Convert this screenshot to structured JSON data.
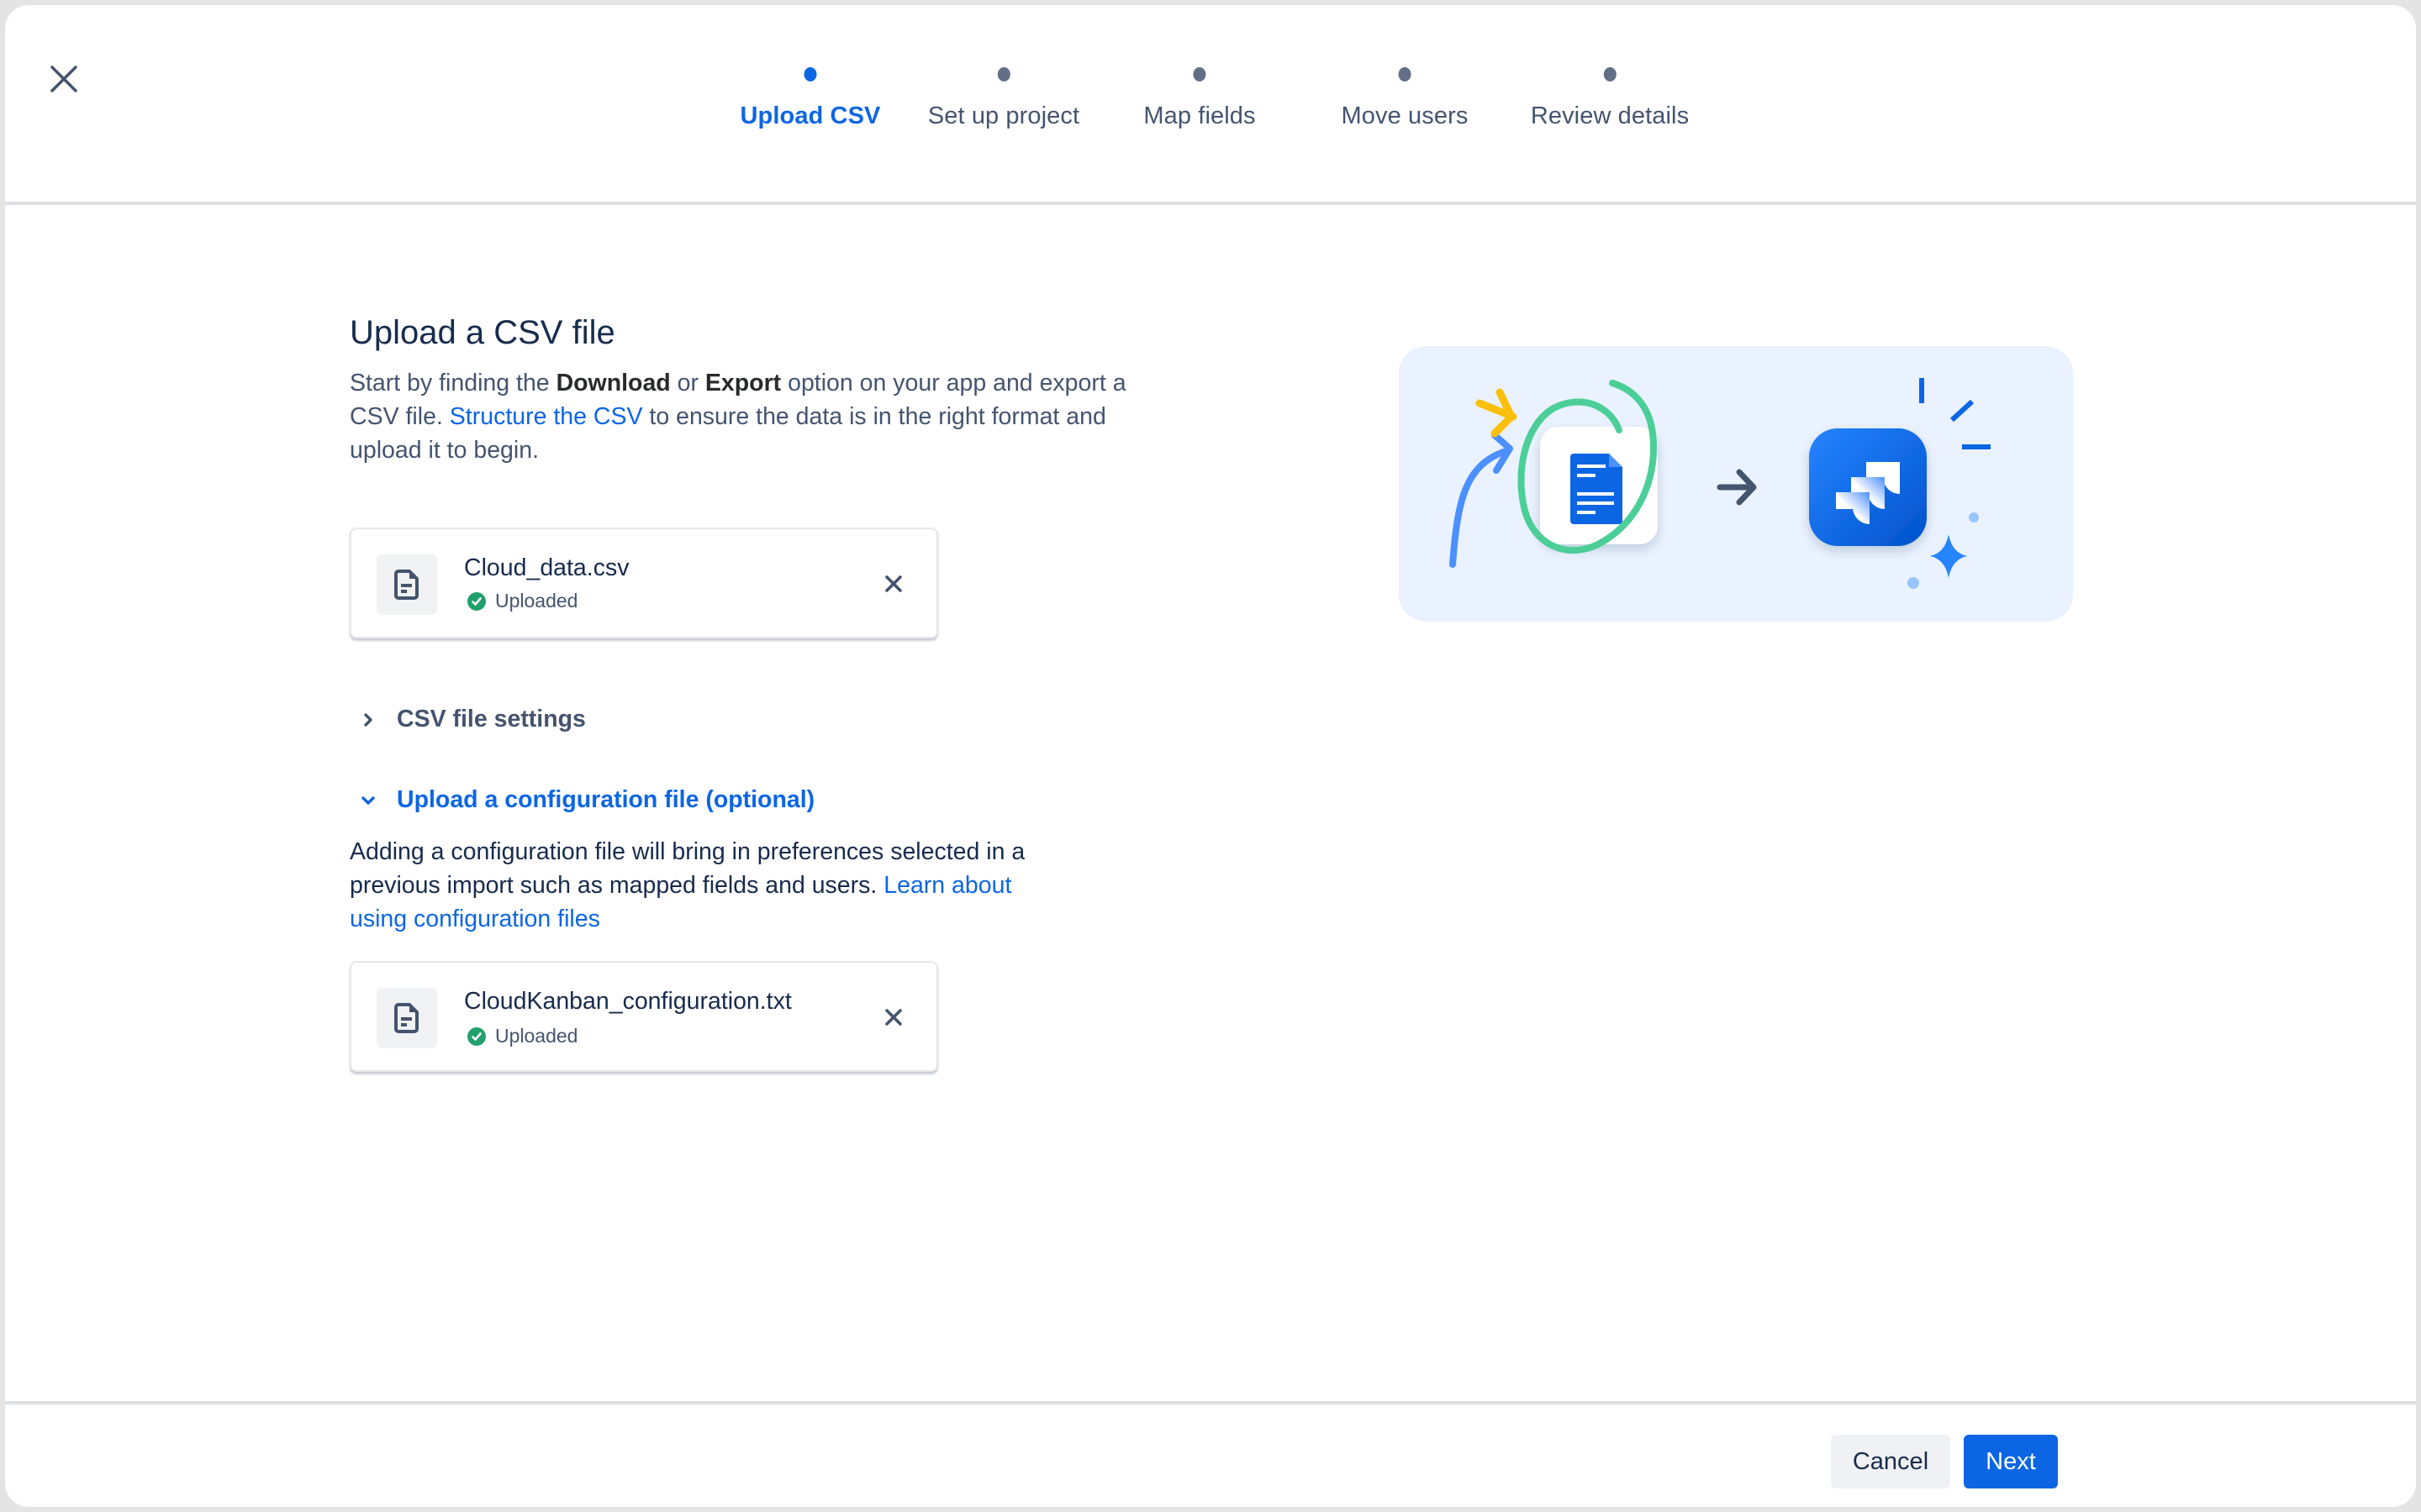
{
  "header": {
    "close_icon": "close-icon",
    "steps": [
      {
        "label": "Upload CSV",
        "state": "active"
      },
      {
        "label": "Set up project",
        "state": "pending"
      },
      {
        "label": "Map fields",
        "state": "pending"
      },
      {
        "label": "Move users",
        "state": "pending"
      },
      {
        "label": "Review details",
        "state": "pending"
      }
    ]
  },
  "main": {
    "title": "Upload a CSV file",
    "intro": {
      "part1": "Start by finding the ",
      "bold1": "Download",
      "part2": " or ",
      "bold2": "Export",
      "part3": " option on your app and export a CSV file. ",
      "link": "Structure the CSV",
      "part4": " to ensure the data is in the right format and upload it to begin."
    },
    "csv_file": {
      "name": "Cloud_data.csv",
      "status": "Uploaded",
      "icon": "file-icon",
      "status_icon": "check-circle-icon",
      "remove_icon": "close-icon"
    },
    "csv_settings": {
      "label": "CSV file settings",
      "expanded": false,
      "icon": "chevron-right-icon"
    },
    "config_section": {
      "label": "Upload a configuration file (optional)",
      "expanded": true,
      "icon": "chevron-down-icon",
      "description": "Adding a configuration file will bring in preferences selected in a previous import such as mapped fields and users. ",
      "link": "Learn about using configuration files"
    },
    "config_file": {
      "name": "CloudKanban_configuration.txt",
      "status": "Uploaded",
      "icon": "file-icon",
      "status_icon": "check-circle-icon",
      "remove_icon": "close-icon"
    },
    "illustration": {
      "description": "Document icon circled, arrow pointing to Jira app icon with sparkles"
    }
  },
  "footer": {
    "cancel_label": "Cancel",
    "next_label": "Next"
  },
  "colors": {
    "accent": "#0c66e4",
    "success": "#22a06b",
    "text": "#172b4d",
    "subtle_text": "#44546f",
    "illustration_bg": "#e9f2fe",
    "highlight_green": "#4bce97",
    "highlight_yellow": "#fbbf0b"
  }
}
